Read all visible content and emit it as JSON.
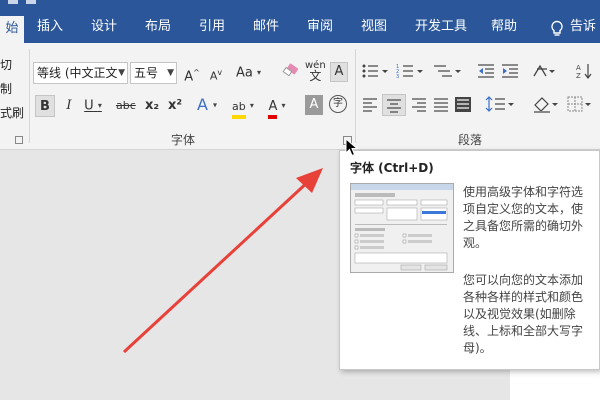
{
  "tabs": [
    {
      "label": "始",
      "active": true
    },
    {
      "label": "插入",
      "active": false
    },
    {
      "label": "设计",
      "active": false
    },
    {
      "label": "布局",
      "active": false
    },
    {
      "label": "引用",
      "active": false
    },
    {
      "label": "邮件",
      "active": false
    },
    {
      "label": "审阅",
      "active": false
    },
    {
      "label": "视图",
      "active": false
    },
    {
      "label": "开发工具",
      "active": false
    },
    {
      "label": "帮助",
      "active": false
    }
  ],
  "tell_me": {
    "label": "告诉",
    "icon": "lightbulb-icon"
  },
  "clipboard_partial": [
    "切",
    "制",
    "式刷"
  ],
  "font_group": {
    "label": "字体",
    "font_name": "等线 (中文正文",
    "font_size": "五号",
    "grow_label": "A",
    "shrink_label": "A",
    "case_label": "Aa",
    "pinyin_label": "wén",
    "border_label": "A",
    "bold": "B",
    "italic": "I",
    "underline": "U",
    "strike": "abc",
    "sub": "x₂",
    "sup": "x²",
    "effects_label": "A",
    "highlight_label": "ab",
    "font_color_label": "A",
    "shading_label": "A",
    "enclose_label": "字",
    "highlight_color": "#ffd800",
    "font_color": "#e00000"
  },
  "paragraph_group": {
    "label": "段落"
  },
  "tooltip": {
    "title": "字体 (Ctrl+D)",
    "para1_lines": [
      "使用高级字体和字符选",
      "项自定义您的文本，使",
      "之具备您所需的确切外",
      "观。"
    ],
    "para2_lines": [
      "您可以向您的文本添加",
      "各种各样的样式和颜色",
      "以及视觉效果(如删除",
      "线、上标和全部大写字",
      "母)。"
    ]
  },
  "colors": {
    "accent": "#2b579a",
    "annotation_arrow": "#e8413a"
  }
}
